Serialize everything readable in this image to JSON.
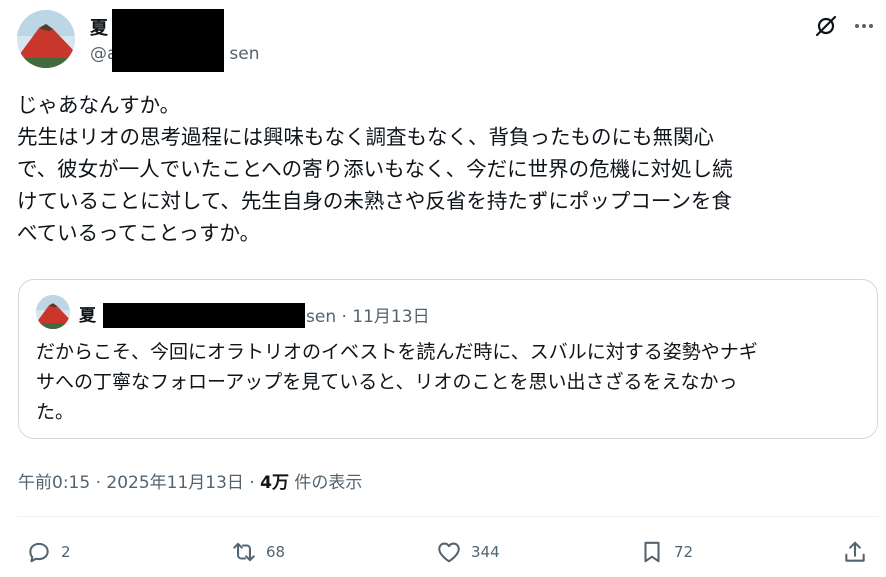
{
  "post": {
    "author_name": "夏",
    "handle_prefix": "@a",
    "handle_suffix": "sen",
    "text": "じゃあなんすか。\n先生はリオの思考過程には興味もなく調査もなく、背負ったものにも無関心\nで、彼女が一人でいたことへの寄り添いもなく、今だに世界の危機に対処し続\nけていることに対して、先生自身の未熟さや反省を持たずにポップコーンを食\nべているってことっすか。"
  },
  "quote": {
    "author_name": "夏",
    "meta_suffix": "sen · 11月13日",
    "text": "だからこそ、今回にオラトリオのイベストを読んだ時に、スバルに対する姿勢やナギ\nサへの丁寧なフォローアップを見ていると、リオのことを思い出さざるをえなかっ\nた。"
  },
  "meta": {
    "time_date": "午前0:15 · 2025年11月13日 · ",
    "views_count": "4万",
    "views_label": " 件の表示"
  },
  "actions": {
    "reply_count": "2",
    "repost_count": "68",
    "like_count": "344",
    "bookmark_count": "72"
  },
  "icons": [
    "grok-icon",
    "more-icon",
    "reply-icon",
    "repost-icon",
    "like-icon",
    "bookmark-icon",
    "share-icon"
  ],
  "colors": {
    "text": "#0f1419",
    "secondary": "#536471",
    "border": "#cfd9de",
    "divider": "#eff3f4"
  }
}
